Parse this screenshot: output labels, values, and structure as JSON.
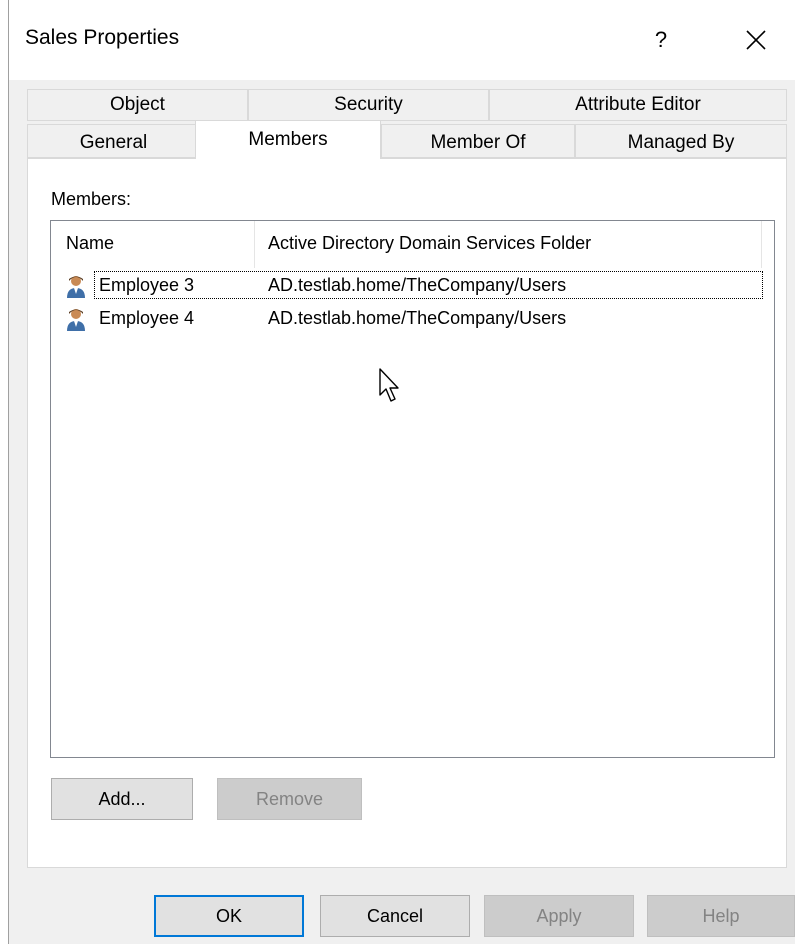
{
  "window": {
    "title": "Sales Properties",
    "help_label": "?"
  },
  "tabs_row1": [
    {
      "label": "Object"
    },
    {
      "label": "Security"
    },
    {
      "label": "Attribute Editor"
    }
  ],
  "tabs_row2": [
    {
      "label": "General"
    },
    {
      "label": "Members",
      "selected": true
    },
    {
      "label": "Member Of"
    },
    {
      "label": "Managed By"
    }
  ],
  "members": {
    "label": "Members:",
    "columns": [
      "Name",
      "Active Directory Domain Services Folder"
    ],
    "rows": [
      {
        "name": "Employee 3",
        "folder": "AD.testlab.home/TheCompany/Users",
        "icon": "user-icon",
        "focused": true
      },
      {
        "name": "Employee 4",
        "folder": "AD.testlab.home/TheCompany/Users",
        "icon": "user-icon"
      }
    ],
    "add_label": "Add...",
    "remove_label": "Remove"
  },
  "footer": {
    "ok_label": "OK",
    "cancel_label": "Cancel",
    "apply_label": "Apply",
    "help_label": "Help"
  },
  "colors": {
    "accent": "#0078d7",
    "dialog_bg": "#f0f0f0"
  }
}
